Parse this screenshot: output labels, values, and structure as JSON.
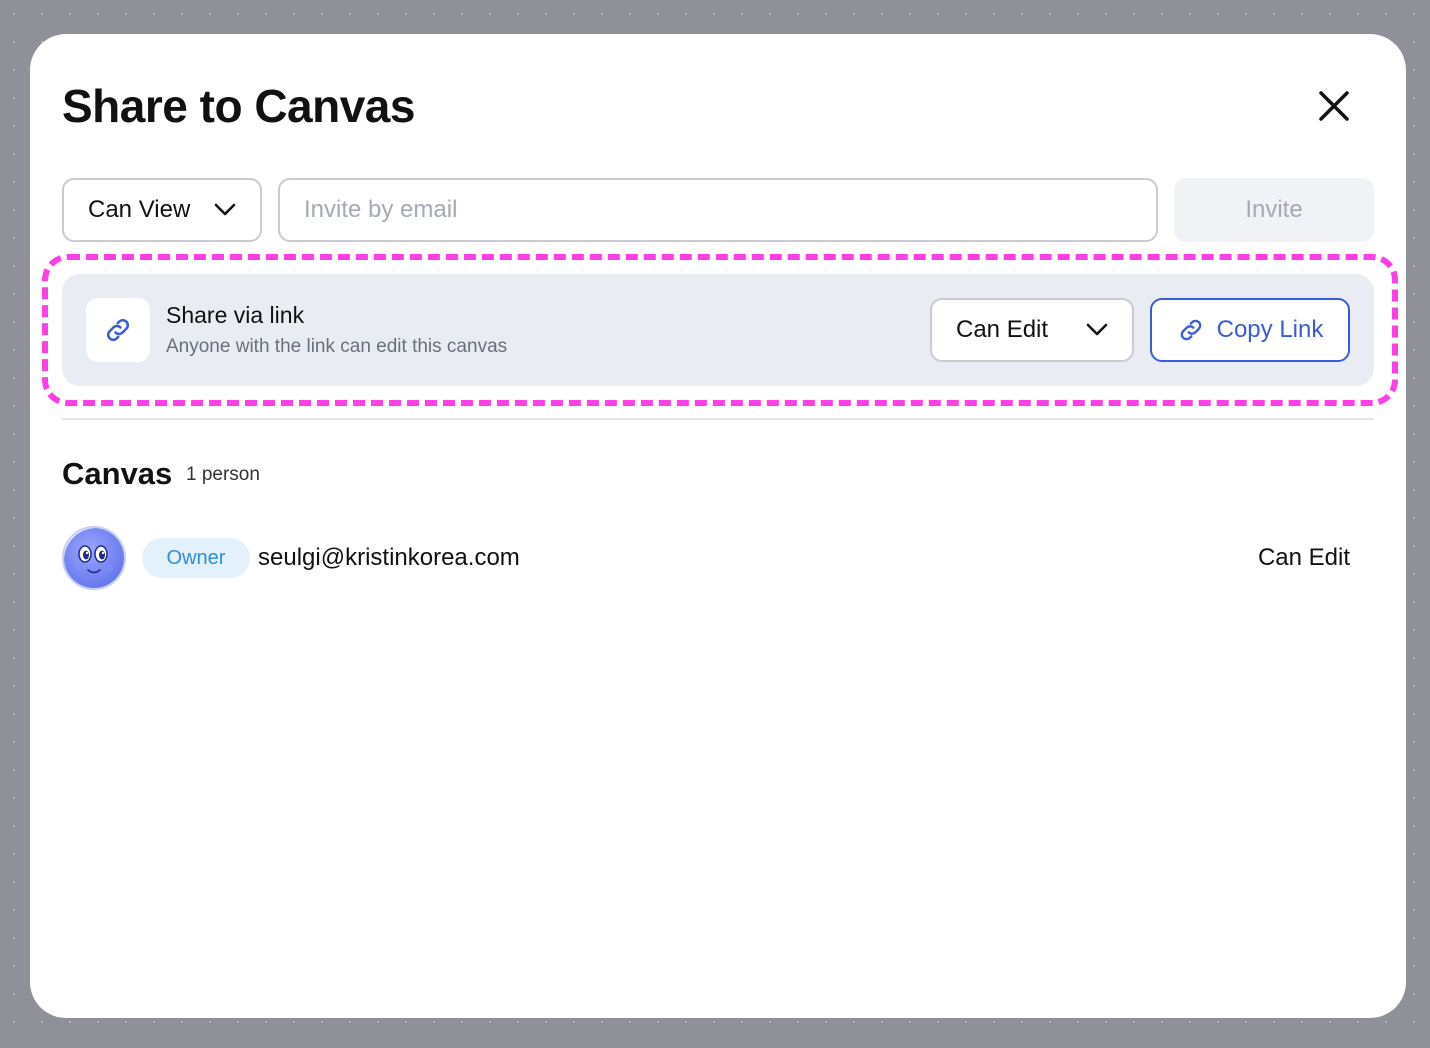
{
  "dialog": {
    "title": "Share to Canvas",
    "close_icon": "close-icon"
  },
  "invite": {
    "permission_label": "Can View",
    "email_value": "",
    "email_placeholder": "Invite by email",
    "invite_label": "Invite"
  },
  "share_link": {
    "icon": "link-icon",
    "title": "Share via link",
    "subtitle": "Anyone with the link can edit this canvas",
    "permission_label": "Can Edit",
    "copy_label": "Copy Link"
  },
  "members": {
    "section_title": "Canvas",
    "count": "1 person",
    "items": [
      {
        "badge": "Owner",
        "email": "seulgi@kristinkorea.com",
        "role": "Can Edit"
      }
    ]
  },
  "colors": {
    "accent": "#3b5bdb",
    "highlight": "#ff3ee6",
    "owner_badge_bg": "#e3f1fd",
    "owner_badge_text": "#2f8fd8"
  }
}
